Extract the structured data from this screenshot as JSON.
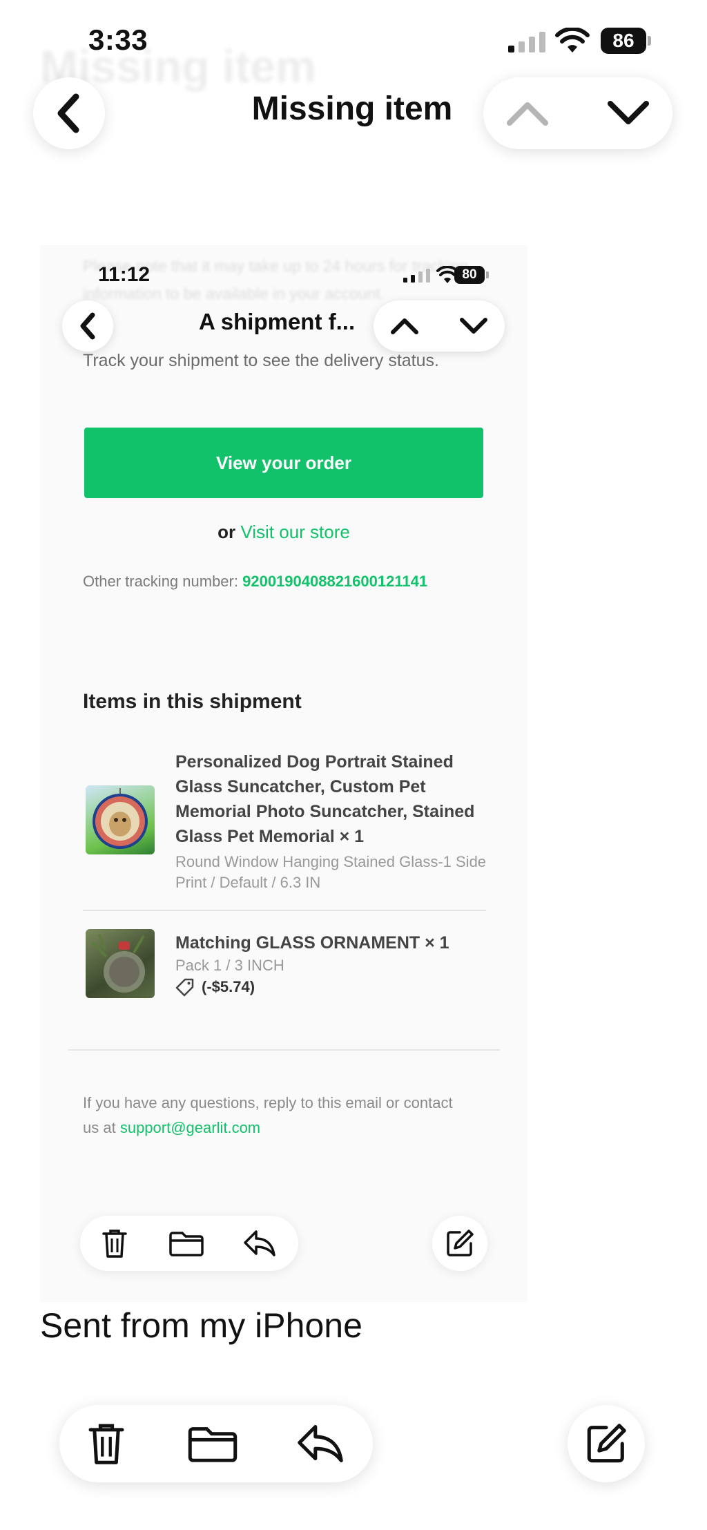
{
  "status_bar": {
    "time": "3:33",
    "battery": "86"
  },
  "header": {
    "title": "Missing item",
    "ghost_title": "Missing item"
  },
  "embedded": {
    "status_time": "11:12",
    "battery": "80",
    "title": "A shipment f...",
    "faded_text": "Please note that it may take up to 24 hours for tracking information to be available in your account.",
    "track_text": "Track your shipment to see the delivery status.",
    "view_order_label": "View your order",
    "or_text": "or",
    "visit_store_label": "Visit our store",
    "other_tracking_label": "Other tracking number:",
    "other_tracking_number": "9200190408821600121141",
    "items_heading": "Items in this shipment",
    "items": [
      {
        "title": "Personalized Dog Portrait Stained Glass Suncatcher, Custom Pet Memorial Photo Suncatcher, Stained Glass Pet Memorial × 1",
        "variant": "Round Window Hanging Stained Glass-1 Side Print / Default / 6.3 IN"
      },
      {
        "title": "Matching GLASS ORNAMENT × 1",
        "variant": "Pack 1 / 3 INCH",
        "discount": "(-$5.74)"
      }
    ],
    "contact_text": "If you have any questions, reply to this email or contact us at",
    "contact_email": "support@gearlit.com"
  },
  "body_text": "Sent from my iPhone",
  "icons": {
    "back": "chevron-left-icon",
    "up": "chevron-up-icon",
    "down": "chevron-down-icon",
    "trash": "trash-icon",
    "folder": "folder-icon",
    "reply": "reply-icon",
    "compose": "compose-icon"
  },
  "colors": {
    "accent_green": "#12c26b"
  }
}
